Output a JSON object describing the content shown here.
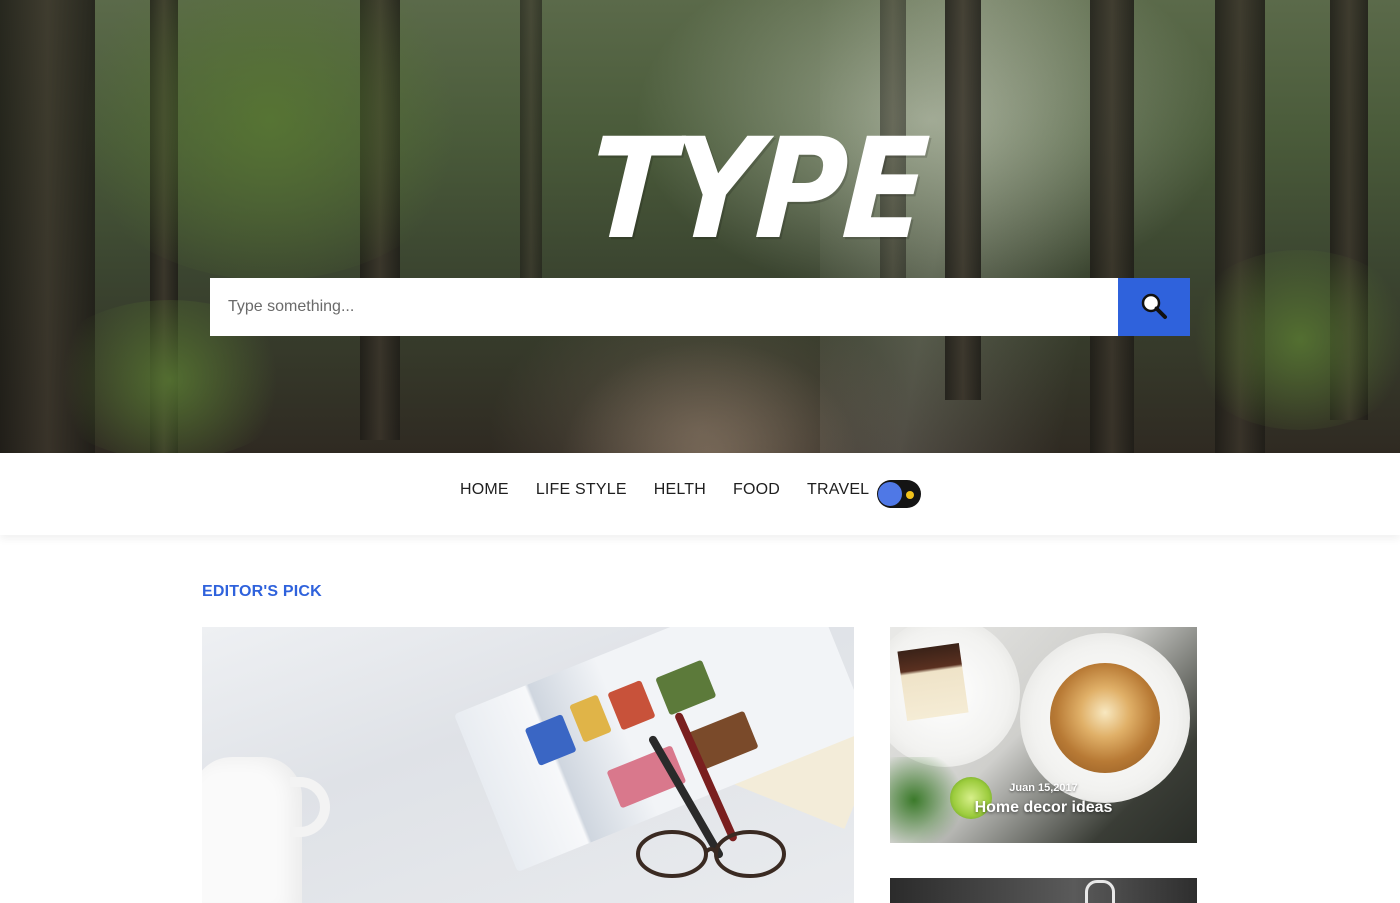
{
  "site": {
    "logo_text": "TYPE"
  },
  "search": {
    "placeholder": "Type something...",
    "button_icon": "search-icon"
  },
  "nav": {
    "items": [
      {
        "label": "HOME"
      },
      {
        "label": "LIFE STYLE"
      },
      {
        "label": "HELTH"
      },
      {
        "label": "FOOD"
      },
      {
        "label": "TRAVEL"
      }
    ],
    "theme_toggle_icon": "sun-icon"
  },
  "editors_pick": {
    "title": "EDITOR'S PICK",
    "cards": [
      {
        "date": "Juan 15,2017",
        "title": "Home decor ideas"
      }
    ]
  },
  "colors": {
    "accent": "#2f62dc",
    "toggle_bg": "#141414",
    "toggle_knob": "#4f78e6",
    "sun": "#f2c21b",
    "nav_text": "#1f1f1f"
  }
}
